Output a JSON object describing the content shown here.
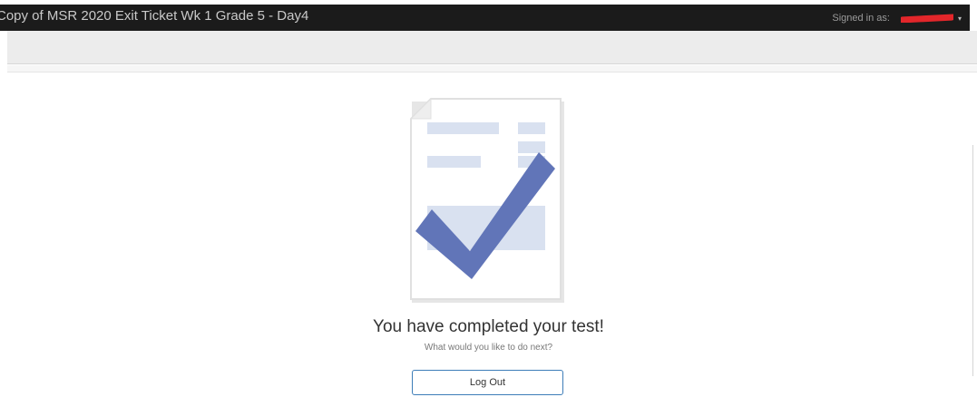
{
  "header": {
    "test_title": "Copy of MSR 2020 Exit Ticket Wk 1 Grade 5 - Day4",
    "signed_in_label": "Signed in as:",
    "user_caret": "▾"
  },
  "completion": {
    "title": "You have completed your test!",
    "subtitle": "What would you like to do next?",
    "logout_label": "Log Out"
  },
  "illustration": {
    "icon": "completed-test-document-checkmark-icon",
    "check_color": "#6175b8",
    "block_color": "#d9e1f0"
  }
}
